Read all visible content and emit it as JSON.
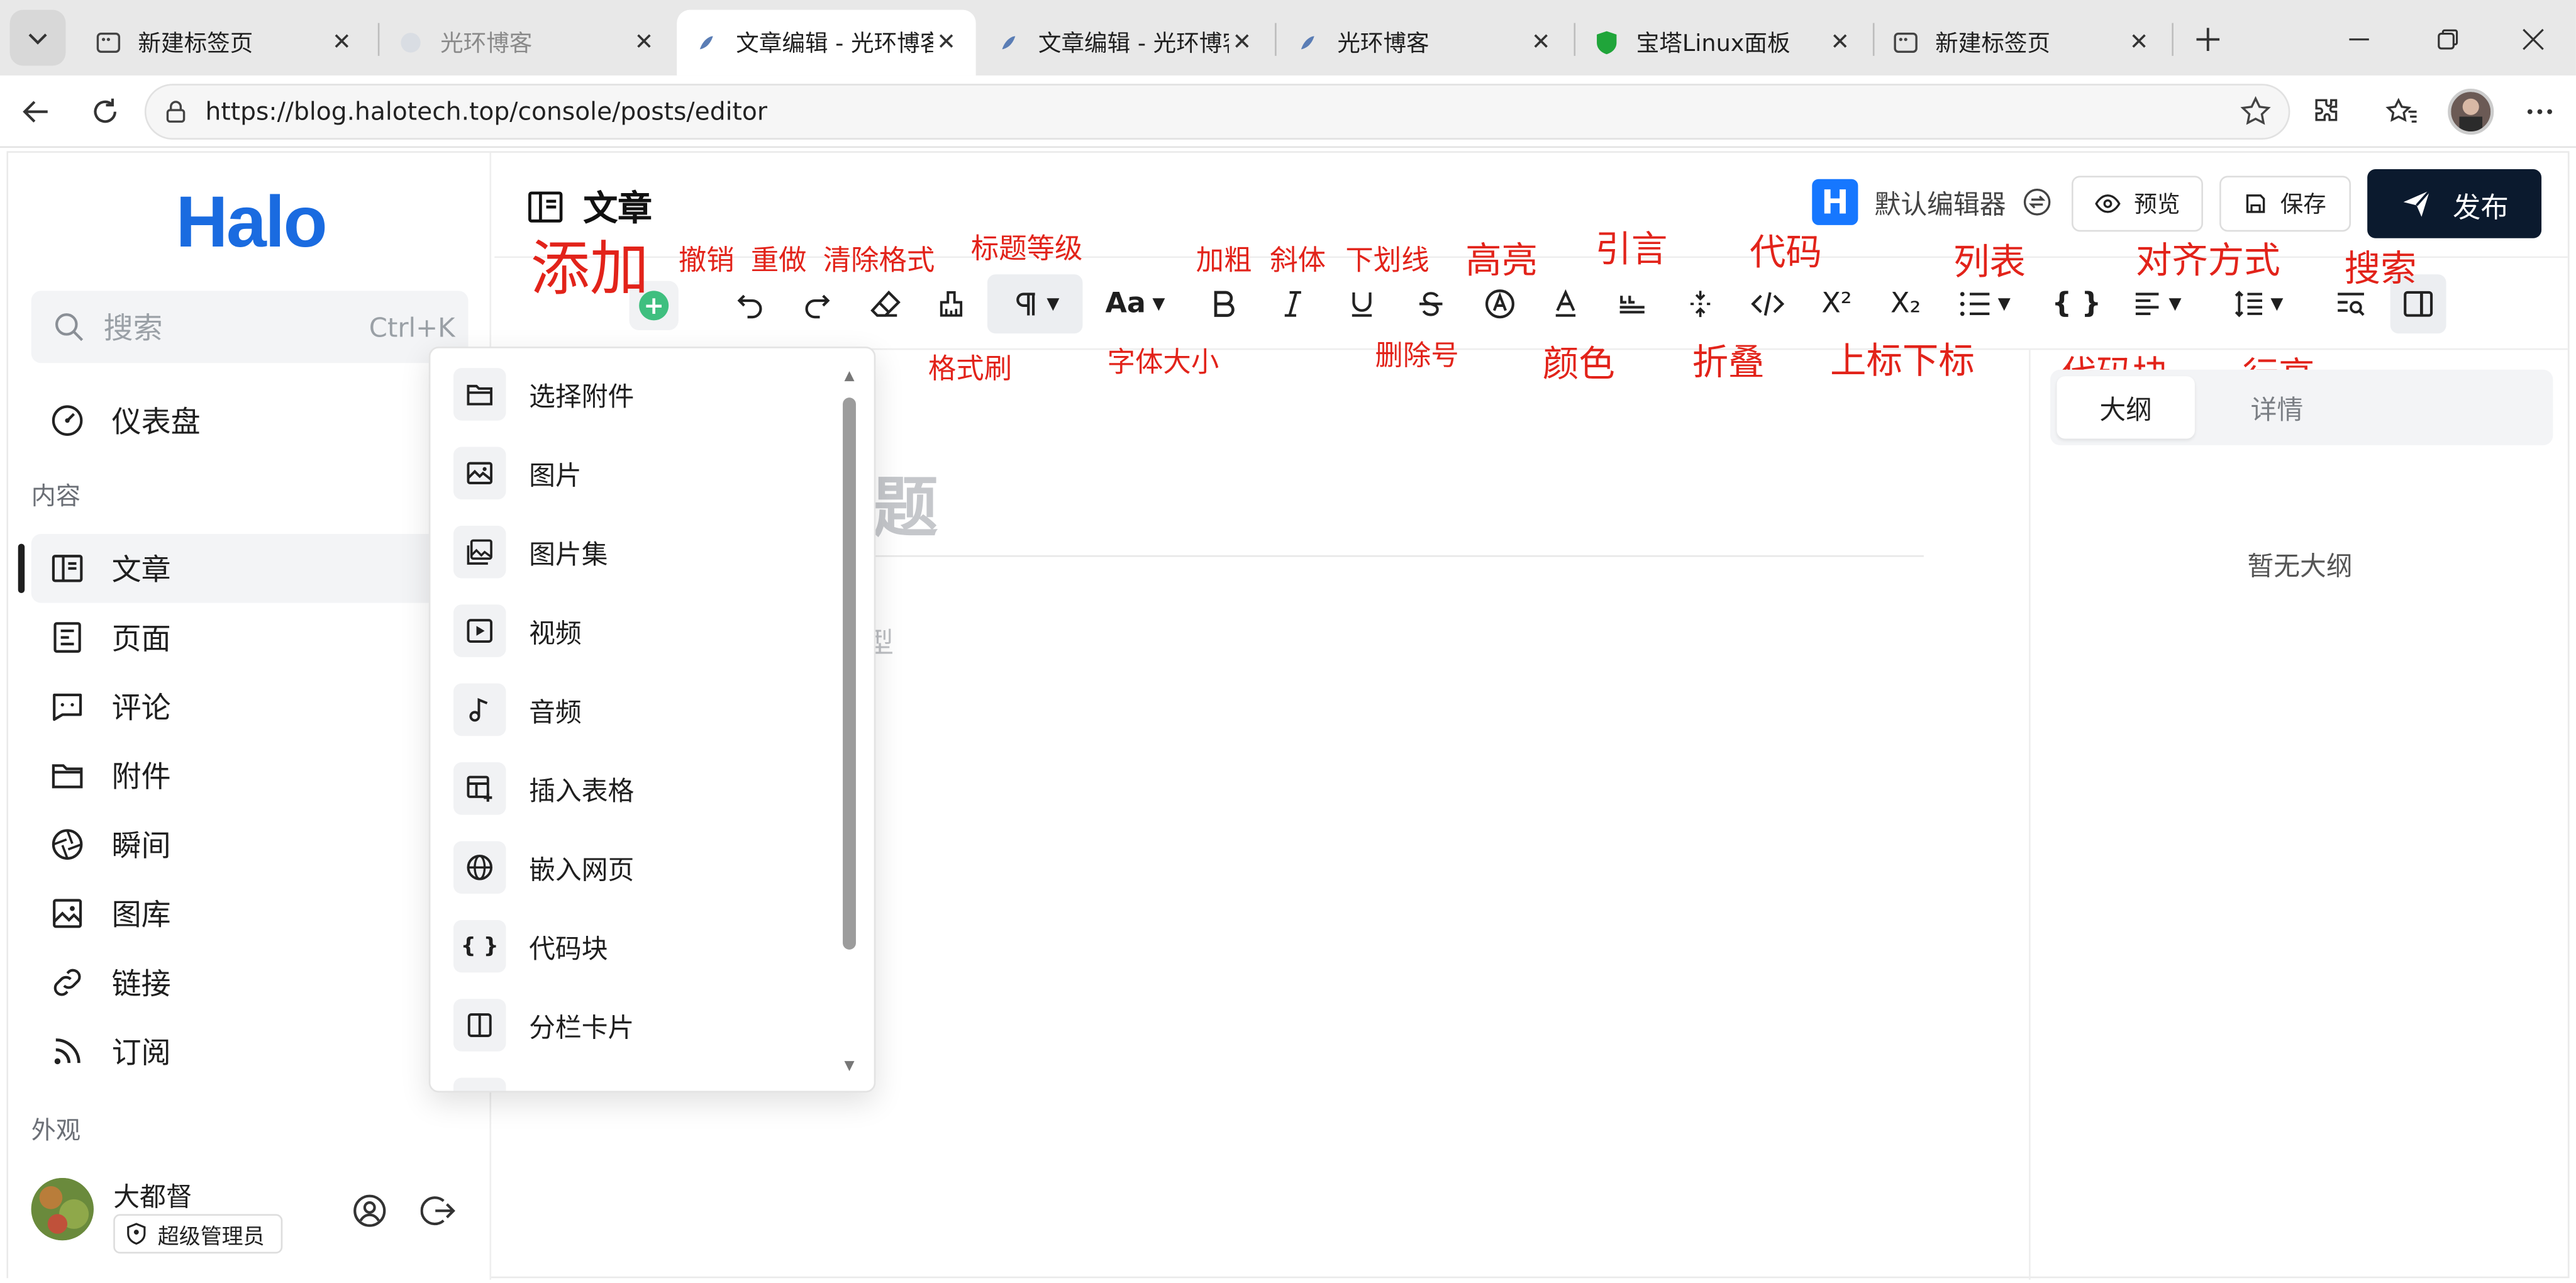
{
  "browser": {
    "tabs": [
      {
        "label": "新建标签页",
        "dim": false,
        "active": false
      },
      {
        "label": "光环博客",
        "dim": true,
        "active": false
      },
      {
        "label": "文章编辑 - 光环博客",
        "dim": false,
        "active": true
      },
      {
        "label": "文章编辑 - 光环博客",
        "dim": false,
        "active": false
      },
      {
        "label": "光环博客",
        "dim": false,
        "active": false
      },
      {
        "label": "宝塔Linux面板",
        "dim": false,
        "active": false
      },
      {
        "label": "新建标签页",
        "dim": false,
        "active": false
      }
    ],
    "url": "https://blog.halotech.top/console/posts/editor"
  },
  "sidebar": {
    "logo": "Halo",
    "search_placeholder": "搜索",
    "search_shortcut": "Ctrl+K",
    "dashboard": "仪表盘",
    "group_content": "内容",
    "items": [
      {
        "label": "文章",
        "icon": "article-icon"
      },
      {
        "label": "页面",
        "icon": "page-icon"
      },
      {
        "label": "评论",
        "icon": "comment-icon"
      },
      {
        "label": "附件",
        "icon": "folder-icon"
      },
      {
        "label": "瞬间",
        "icon": "aperture-icon"
      },
      {
        "label": "图库",
        "icon": "image-icon"
      },
      {
        "label": "链接",
        "icon": "link-icon"
      },
      {
        "label": "订阅",
        "icon": "rss-icon"
      }
    ],
    "group_appearance": "外观",
    "user": {
      "name": "大都督",
      "role": "超级管理员"
    }
  },
  "header": {
    "title": "文章",
    "editor_name": "默认编辑器",
    "editor_logo": "H",
    "preview": "预览",
    "save": "保存",
    "publish": "发布"
  },
  "annotations": {
    "add": "添加",
    "undo": "撤销",
    "redo": "重做",
    "clear": "清除格式",
    "heading": "标题等级",
    "painter": "格式刷",
    "fontsize": "字体大小",
    "bold": "加粗",
    "italic": "斜体",
    "underline": "下划线",
    "strike": "删除号",
    "highlight": "高亮",
    "color": "颜色",
    "quote": "引言",
    "fold": "折叠",
    "code": "代码",
    "supsub": "上标下标",
    "list": "列表",
    "codeblock": "代码块",
    "align": "对齐方式",
    "lineheight": "行高",
    "search": "搜索"
  },
  "editor": {
    "title_ghost": "题",
    "body_ghost": "型"
  },
  "right_panel": {
    "tab_outline": "大纲",
    "tab_detail": "详情",
    "empty": "暂无大纲"
  },
  "insert_menu": [
    {
      "label": "选择附件",
      "icon": "folder-icon"
    },
    {
      "label": "图片",
      "icon": "image-icon"
    },
    {
      "label": "图片集",
      "icon": "gallery-icon"
    },
    {
      "label": "视频",
      "icon": "video-icon"
    },
    {
      "label": "音频",
      "icon": "audio-icon"
    },
    {
      "label": "插入表格",
      "icon": "table-icon"
    },
    {
      "label": "嵌入网页",
      "icon": "globe-icon"
    },
    {
      "label": "代码块",
      "icon": "codeblock-icon"
    },
    {
      "label": "分栏卡片",
      "icon": "columns-icon"
    }
  ],
  "colors": {
    "brand": "#1a6be0",
    "annotation": "#e2231a",
    "publish_bg": "#0b1a2e",
    "add_green": "#3fbf7f"
  }
}
